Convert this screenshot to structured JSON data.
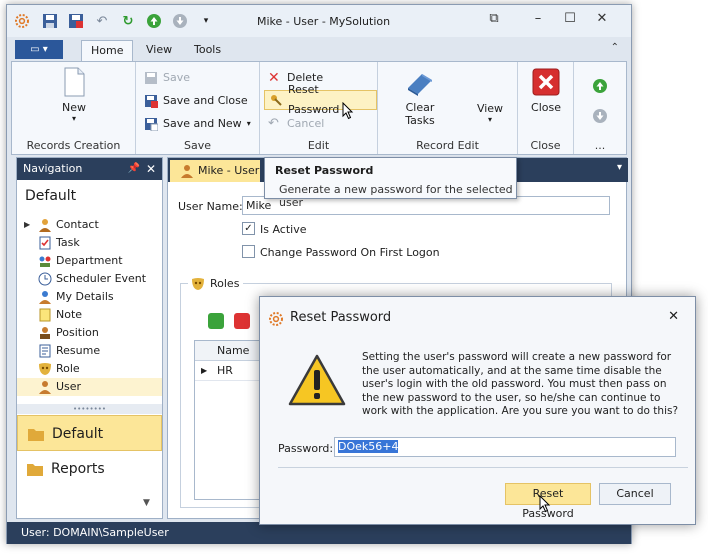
{
  "window": {
    "title": "Mike - User - MySolution"
  },
  "ribbon_tabs": [
    "Home",
    "View",
    "Tools"
  ],
  "ribbon": {
    "records_creation": {
      "label": "Records Creation",
      "new": "New"
    },
    "save": {
      "label": "Save",
      "save": "Save",
      "save_close": "Save and Close",
      "save_new": "Save and New"
    },
    "edit": {
      "label": "Edit",
      "delete": "Delete",
      "reset_password": "Reset Password",
      "cancel": "Cancel"
    },
    "record_edit": {
      "label": "Record Edit",
      "clear_tasks": "Clear\nTasks",
      "clear_line1": "Clear",
      "clear_line2": "Tasks",
      "view": "View"
    },
    "close": {
      "label": "Close",
      "close": "Close"
    },
    "more": {
      "label": "..."
    }
  },
  "navigation": {
    "header": "Navigation",
    "section": "Default",
    "items": [
      "Contact",
      "Task",
      "Department",
      "Scheduler Event",
      "My Details",
      "Note",
      "Position",
      "Resume",
      "Role",
      "User"
    ],
    "groups": [
      "Default",
      "Reports"
    ]
  },
  "document": {
    "tab": "Mike - User",
    "user_name_label": "User Name:",
    "user_name_value": "Mike",
    "is_active_label": "Is Active",
    "is_active_checked": true,
    "change_pw_label": "Change Password On First Logon",
    "change_pw_checked": false,
    "roles_title": "Roles",
    "grid_header": "Name",
    "grid_rows": [
      "HR"
    ]
  },
  "tooltip": {
    "title": "Reset Password",
    "description": "Generate a new password for the selected user"
  },
  "status": {
    "text": "User: DOMAIN\\SampleUser"
  },
  "dialog": {
    "title": "Reset Password",
    "message": "Setting the user's password will create a new password for the user automatically, and at the same time disable the user's login with the old password. You must then pass on the new password to the user, so he/she can continue to work with the application. Are you sure you want to do this?",
    "password_label": "Password:",
    "password_value": "DOek56+4",
    "ok_label": "Reset Password",
    "cancel_label": "Cancel"
  },
  "colors": {
    "accent_dark": "#2b3f5c",
    "selection_yellow": "#fce698",
    "app_button": "#2b579a"
  }
}
